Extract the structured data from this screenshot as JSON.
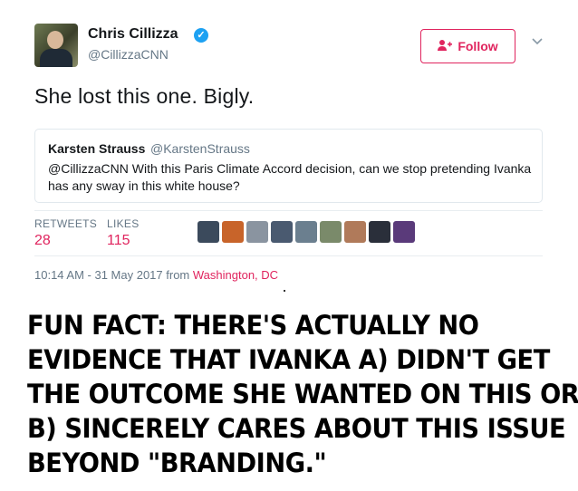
{
  "tweet": {
    "author_name": "Chris Cillizza",
    "author_handle": "@CillizzaCNN",
    "follow_label": "Follow",
    "text": "She lost this one. Bigly.",
    "icons": {
      "verified": "verified-badge-icon",
      "follow": "add-user-icon",
      "menu": "chevron-down-icon"
    }
  },
  "quoted": {
    "name": "Karsten Strauss",
    "handle": "@KarstenStrauss",
    "text": "@CillizzaCNN With this Paris Climate Accord decision, can we stop pretending Ivanka has any sway in this white house?"
  },
  "stats": {
    "retweets_label": "RETWEETS",
    "retweets_value": "28",
    "likes_label": "LIKES",
    "likes_value": "115"
  },
  "likers": [
    {
      "color": "#3b4a5c"
    },
    {
      "color": "#c8642a"
    },
    {
      "color": "#8a94a0"
    },
    {
      "color": "#4a5a70"
    },
    {
      "color": "#6b7f8f"
    },
    {
      "color": "#7a8a6a"
    },
    {
      "color": "#b07a5a"
    },
    {
      "color": "#2a2f3a"
    },
    {
      "color": "#5a3a7a"
    }
  ],
  "meta": {
    "time": "10:14 AM - 31 May 2017 from ",
    "location": "Washington, DC"
  },
  "caption": {
    "lines": [
      "FUN FACT: THERE'S ACTUALLY NO",
      "EVIDENCE THAT IVANKA A) DIDN'T GET",
      "THE OUTCOME SHE WANTED ON THIS OR",
      "B) SINCERELY CARES ABOUT THIS ISSUE",
      "BEYOND \"BRANDING.\""
    ]
  },
  "colors": {
    "accent": "#e0245e",
    "verified": "#1da1f2",
    "muted": "#657786"
  }
}
